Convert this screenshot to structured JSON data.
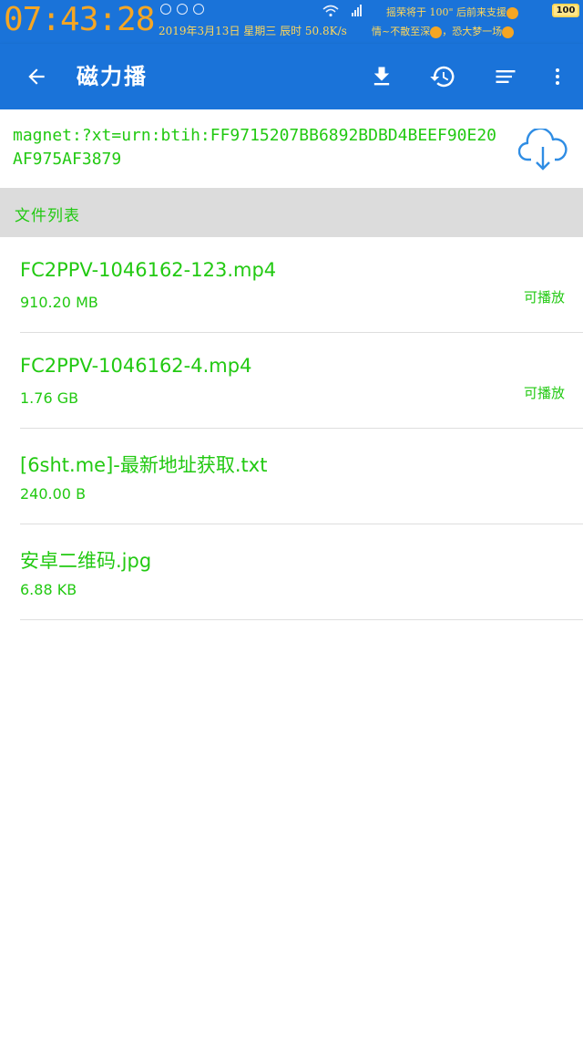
{
  "statusbar": {
    "time": "07:43:28",
    "date_line": "2019年3月13日 星期三 辰时 50.8K/s",
    "note_top": "摇荣将于 100\" 后前来支援",
    "note_bottom": "情~不散至深",
    "note_bottom_tail": "，恐大梦一场",
    "battery": "100",
    "colors": {
      "time": "#f5a623",
      "note": "#ffd75a"
    }
  },
  "appbar": {
    "title": "磁力播",
    "icons": [
      "back-arrow-icon",
      "download-icon",
      "history-icon",
      "sort-icon",
      "more-vert-icon"
    ],
    "color": "#1a73d9"
  },
  "magnet": {
    "uri": "magnet:?xt=urn:btih:FF9715207BB6892BDBD4BEEF90E20AF975AF3879",
    "icon": "cloud-download-icon"
  },
  "section": {
    "label": "文件列表"
  },
  "files": [
    {
      "name": "FC2PPV-1046162-123.mp4",
      "size": "910.20 MB",
      "status": "可播放"
    },
    {
      "name": "FC2PPV-1046162-4.mp4",
      "size": "1.76 GB",
      "status": "可播放"
    },
    {
      "name": "[6sht.me]-最新地址获取.txt",
      "size": "240.00 B",
      "status": ""
    },
    {
      "name": "安卓二维码.jpg",
      "size": "6.88 KB",
      "status": ""
    }
  ],
  "colors": {
    "accent_text": "#22c912",
    "header_bg": "#dcdcdc"
  }
}
